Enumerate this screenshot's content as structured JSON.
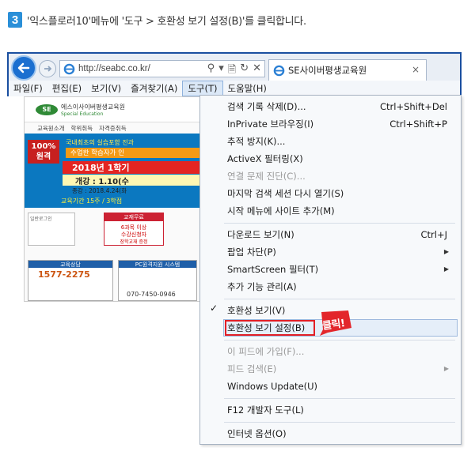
{
  "step": {
    "number": "3",
    "text": "'익스플로러10'메뉴에 '도구 > 호환성 보기 설정(B)'를 클릭합니다."
  },
  "browser": {
    "url": "http://seabc.co.kr/",
    "address_icons": [
      "search-icon",
      "dropdown-icon",
      "compat-view-icon",
      "refresh-icon",
      "stop-icon"
    ],
    "tab_title": "SE사이버평생교육원",
    "tab_close": "×",
    "menu": [
      "파일(F)",
      "편집(E)",
      "보기(V)",
      "즐겨찾기(A)",
      "도구(T)",
      "도움말(H)"
    ],
    "active_menu": "도구(T)"
  },
  "site": {
    "logo": "SE",
    "name": "에스이사이버평생교육원",
    "subtitle": "Special Education",
    "nav": [
      "교육원소개",
      "학위취득",
      "자격증취득"
    ],
    "badge": "100%\n원격",
    "line1": "국내최초의 실습포함 전과",
    "line2": "수업한 학습자가 인",
    "year": "2018년 1학기",
    "open": "개강 : 1.10(수",
    "end": "종강 : 2018.4.24(화",
    "period": "교육기간 15주 / 3학점",
    "login_title": "일반로그인",
    "promo_title": "교재무료",
    "promo_text": "6과목 이상\n수강신청자",
    "promo_sub": "장학교재 증정",
    "consult_title": "교육상담",
    "consult_phone": "1577-2275",
    "remote_title": "PC원격지원 시스템",
    "remote_phone": "070-7450-0946"
  },
  "dropdown": {
    "items": [
      {
        "label": "검색 기록 삭제(D)...",
        "shortcut": "Ctrl+Shift+Del",
        "disabled": false
      },
      {
        "label": "InPrivate 브라우징(I)",
        "shortcut": "Ctrl+Shift+P",
        "disabled": false
      },
      {
        "label": "추적 방지(K)...",
        "shortcut": "",
        "disabled": false
      },
      {
        "label": "ActiveX 필터링(X)",
        "shortcut": "",
        "disabled": false
      },
      {
        "label": "연결 문제 진단(C)...",
        "shortcut": "",
        "disabled": true
      },
      {
        "label": "마지막 검색 세션 다시 열기(S)",
        "shortcut": "",
        "disabled": false
      },
      {
        "label": "시작 메뉴에 사이트 추가(M)",
        "shortcut": "",
        "disabled": false
      },
      {
        "label": "다운로드 보기(N)",
        "shortcut": "Ctrl+J",
        "disabled": false
      },
      {
        "label": "팝업 차단(P)",
        "shortcut": "",
        "submenu": true,
        "disabled": false
      },
      {
        "label": "SmartScreen 필터(T)",
        "shortcut": "",
        "submenu": true,
        "disabled": false
      },
      {
        "label": "추가 기능 관리(A)",
        "shortcut": "",
        "disabled": false
      },
      {
        "label": "호환성 보기(V)",
        "shortcut": "",
        "checked": true,
        "disabled": false
      },
      {
        "label": "호환성 보기 설정(B)",
        "shortcut": "",
        "highlighted": true,
        "disabled": false
      },
      {
        "label": "이 피드에 가입(F)...",
        "shortcut": "",
        "disabled": true
      },
      {
        "label": "피드 검색(E)",
        "shortcut": "",
        "submenu": true,
        "disabled": true
      },
      {
        "label": "Windows Update(U)",
        "shortcut": "",
        "disabled": false
      },
      {
        "label": "F12 개발자 도구(L)",
        "shortcut": "",
        "disabled": false
      },
      {
        "label": "인터넷 옵션(O)",
        "shortcut": "",
        "disabled": false
      }
    ],
    "callout": "클릭!"
  }
}
